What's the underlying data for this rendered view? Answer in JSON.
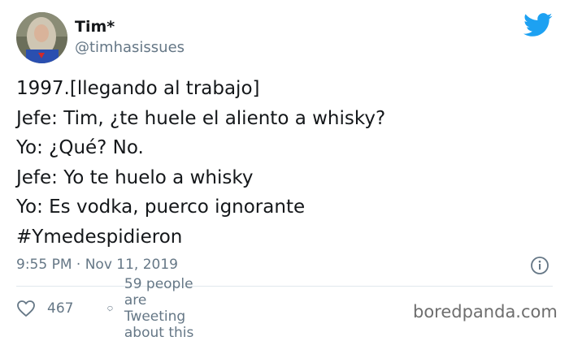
{
  "author": {
    "name": "Tim*",
    "handle": "@timhasissues"
  },
  "tweet": {
    "lines": [
      "1997.[llegando al trabajo]",
      "Jefe: Tim, ¿te huele el aliento a whisky?",
      "Yo: ¿Qué? No.",
      "Jefe: Yo te huelo a whisky",
      "Yo: Es vodka, puerco ignorante",
      "#Ymedespidieron"
    ],
    "timestamp": "9:55 PM · Nov 11, 2019"
  },
  "actions": {
    "likes": "467",
    "replies_text": "59 people are Tweeting about this"
  },
  "watermark": "boredpanda.com",
  "icons": {
    "platform": "twitter-bird-icon",
    "info": "info-icon",
    "like": "heart-icon",
    "reply": "comment-bubble-icon"
  },
  "colors": {
    "accent": "#1da1f2",
    "text": "#14171a",
    "secondary": "#657786",
    "divider": "#e1e8ed"
  }
}
